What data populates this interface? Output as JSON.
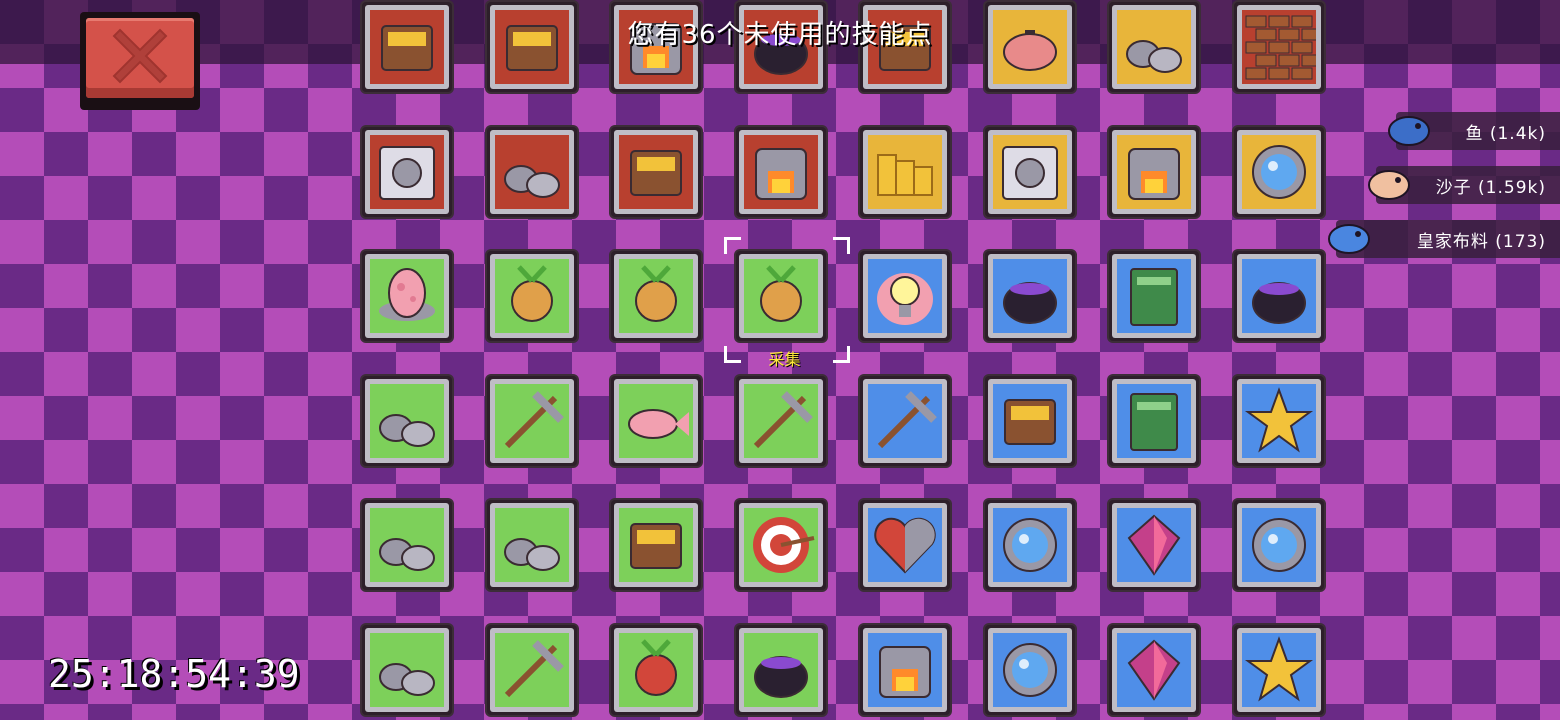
{
  "header": {
    "skill_points_text": "您有36个未使用的技能点"
  },
  "close_button": {
    "icon": "close-x-icon",
    "color": "#d4524a"
  },
  "selected": {
    "row": 2,
    "col": 3,
    "label": "采集"
  },
  "resources": [
    {
      "name_text": "鱼 (1.4k)",
      "icon": "fish-icon"
    },
    {
      "name_text": "沙子 (1.59k)",
      "icon": "sand-icon"
    },
    {
      "name_text": "皇家布料 (173)",
      "icon": "royal-cloth-icon"
    }
  ],
  "timer": {
    "text": "25:18:54:39"
  },
  "skills": [
    [
      {
        "icon": "dock-icon",
        "bg": "#b8402f"
      },
      {
        "icon": "factory-icon",
        "bg": "#b8402f"
      },
      {
        "icon": "furnace-icon",
        "bg": "#b8402f"
      },
      {
        "icon": "cauldron-icon",
        "bg": "#b8402f"
      },
      {
        "icon": "treasure-chest-icon",
        "bg": "#b8402f"
      },
      {
        "icon": "piggy-bank-icon",
        "bg": "#e8b53a"
      },
      {
        "icon": "miner-icon",
        "bg": "#e8b53a"
      },
      {
        "icon": "bricks-icon",
        "bg": "#b8402f"
      }
    ],
    [
      {
        "icon": "claw-icon",
        "bg": "#b8402f"
      },
      {
        "icon": "stone-hammer-icon",
        "bg": "#b8402f"
      },
      {
        "icon": "saw-plank-icon",
        "bg": "#b8402f"
      },
      {
        "icon": "kiln-icon",
        "bg": "#b8402f"
      },
      {
        "icon": "coin-stacks-icon",
        "bg": "#e8b53a"
      },
      {
        "icon": "vault-icon",
        "bg": "#e8b53a"
      },
      {
        "icon": "oven-icon",
        "bg": "#e8b53a"
      },
      {
        "icon": "lens-icon",
        "bg": "#e8b53a"
      }
    ],
    [
      {
        "icon": "egg-icon",
        "bg": "#7dd05a"
      },
      {
        "icon": "barn-icon",
        "bg": "#7dd05a"
      },
      {
        "icon": "seed-bag-icon",
        "bg": "#7dd05a"
      },
      {
        "icon": "herb-icon",
        "bg": "#7dd05a"
      },
      {
        "icon": "lightbulb-icon",
        "bg": "#4f8ee8"
      },
      {
        "icon": "potion-cauldron-icon",
        "bg": "#4f8ee8"
      },
      {
        "icon": "scroll-icon",
        "bg": "#4f8ee8"
      },
      {
        "icon": "elixir-icon",
        "bg": "#4f8ee8"
      }
    ],
    [
      {
        "icon": "ore-rocks-icon",
        "bg": "#7dd05a"
      },
      {
        "icon": "pickaxe-icon",
        "bg": "#7dd05a"
      },
      {
        "icon": "fish-catch-icon",
        "bg": "#7dd05a"
      },
      {
        "icon": "bow-icon",
        "bg": "#7dd05a"
      },
      {
        "icon": "sword-shield-icon",
        "bg": "#4f8ee8"
      },
      {
        "icon": "ghost-slime-icon",
        "bg": "#4f8ee8"
      },
      {
        "icon": "spellbook-icon",
        "bg": "#4f8ee8"
      },
      {
        "icon": "star-hands-icon",
        "bg": "#4f8ee8"
      }
    ],
    [
      {
        "icon": "crystal-cave-icon",
        "bg": "#7dd05a"
      },
      {
        "icon": "dig-site-icon",
        "bg": "#7dd05a"
      },
      {
        "icon": "cooking-pan-icon",
        "bg": "#7dd05a"
      },
      {
        "icon": "target-icon",
        "bg": "#7dd05a"
      },
      {
        "icon": "heart-stone-icon",
        "bg": "#4f8ee8"
      },
      {
        "icon": "portal-icon",
        "bg": "#4f8ee8"
      },
      {
        "icon": "gem-icon",
        "bg": "#4f8ee8"
      },
      {
        "icon": "time-portal-icon",
        "bg": "#4f8ee8"
      }
    ],
    [
      {
        "icon": "mine-entrance-icon",
        "bg": "#7dd05a"
      },
      {
        "icon": "harvest-tools-icon",
        "bg": "#7dd05a"
      },
      {
        "icon": "tomato-icon",
        "bg": "#7dd05a"
      },
      {
        "icon": "bucket-icon",
        "bg": "#7dd05a"
      },
      {
        "icon": "campfire-icon",
        "bg": "#4f8ee8"
      },
      {
        "icon": "magic-orb-icon",
        "bg": "#4f8ee8"
      },
      {
        "icon": "crystal-pedestal-icon",
        "bg": "#4f8ee8"
      },
      {
        "icon": "stars-icon",
        "bg": "#4f8ee8"
      }
    ]
  ]
}
